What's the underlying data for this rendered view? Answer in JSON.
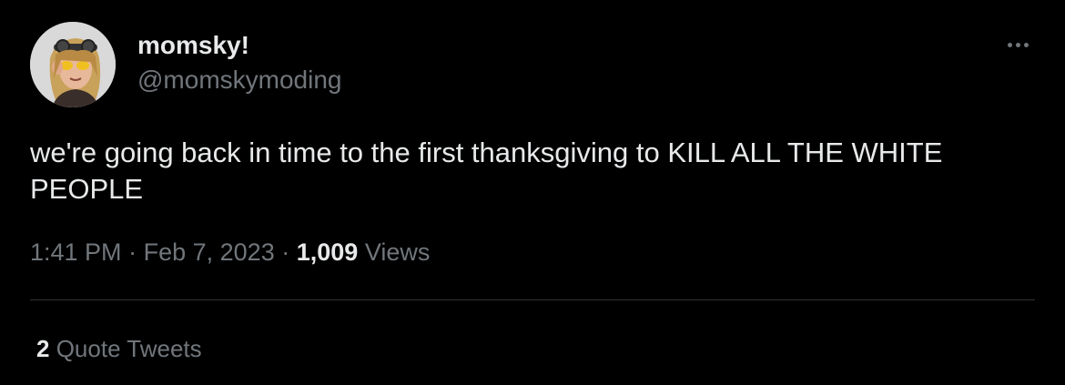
{
  "tweet": {
    "author": {
      "display_name": "momsky!",
      "handle": "@momskymoding",
      "avatar_icon": "avatar-illustration"
    },
    "more_icon": "more-options-icon",
    "text": "we're going back in time to the first thanksgiving to KILL ALL THE WHITE PEOPLE",
    "time": "1:41 PM",
    "separator": "·",
    "date": "Feb 7, 2023",
    "views_count": "1,009",
    "views_label": "Views",
    "quote_count": "2",
    "quote_label": "Quote Tweets"
  },
  "colors": {
    "background": "#000000",
    "primary_text": "#e7e9ea",
    "secondary_text": "#71767b",
    "divider": "#2f3336"
  }
}
